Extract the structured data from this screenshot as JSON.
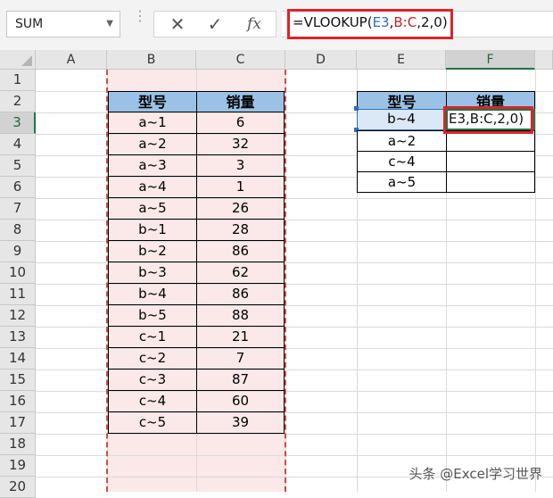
{
  "formula_bar": {
    "name_box": "SUM",
    "cancel_glyph": "✕",
    "enter_glyph": "✓",
    "fx_label": "fx",
    "formula_prefix": "=VLOOKUP(",
    "formula_ref1": "E3",
    "formula_comma1": ",",
    "formula_ref2": "B:C",
    "formula_suffix": ",2,0)"
  },
  "columns": [
    "A",
    "B",
    "C",
    "D",
    "E",
    "F"
  ],
  "rows": [
    "1",
    "2",
    "3",
    "4",
    "5",
    "6",
    "7",
    "8",
    "9",
    "10",
    "11",
    "12",
    "13",
    "14",
    "15",
    "16",
    "17",
    "18",
    "19",
    "20"
  ],
  "selected_column": "F",
  "selected_row": "3",
  "source_table": {
    "headers": [
      "型号",
      "销量"
    ],
    "rows": [
      [
        "a~1",
        "6"
      ],
      [
        "a~2",
        "32"
      ],
      [
        "a~3",
        "3"
      ],
      [
        "a~4",
        "1"
      ],
      [
        "a~5",
        "26"
      ],
      [
        "b~1",
        "28"
      ],
      [
        "b~2",
        "86"
      ],
      [
        "b~3",
        "62"
      ],
      [
        "b~4",
        "86"
      ],
      [
        "b~5",
        "88"
      ],
      [
        "c~1",
        "21"
      ],
      [
        "c~2",
        "7"
      ],
      [
        "c~3",
        "87"
      ],
      [
        "c~4",
        "60"
      ],
      [
        "c~5",
        "39"
      ]
    ]
  },
  "lookup_table": {
    "headers": [
      "型号",
      "销量"
    ],
    "keys": [
      "b~4",
      "a~2",
      "c~4",
      "a~5"
    ],
    "editing_text": "E3,B:C,2,0)"
  },
  "colors": {
    "header_fill": "#9bc2e6",
    "highlight_fill": "#fbe8e8",
    "highlight_border": "#c0504d",
    "callout_red": "#d9252a",
    "selection_green": "#217346"
  },
  "watermark": "头条 @Excel学习世界"
}
